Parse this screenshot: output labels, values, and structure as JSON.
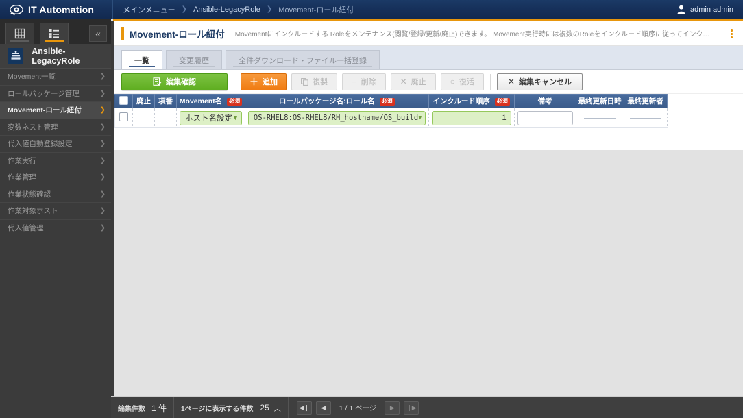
{
  "topbar": {
    "brand": "IT Automation",
    "logo_icon": "eye-logo-icon",
    "breadcrumb": [
      {
        "label": "メインメニュー",
        "type": "link"
      },
      {
        "label": "Ansible-LegacyRole",
        "type": "link"
      },
      {
        "label": "Movement-ロール紐付",
        "type": "current"
      }
    ],
    "breadcrumb_separator": "❯",
    "user": {
      "name": "admin admin",
      "icon": "user-avatar-icon"
    }
  },
  "sidebar": {
    "tabs": [
      {
        "name": "grid-view-icon",
        "active": false
      },
      {
        "name": "list-view-icon",
        "active": true
      }
    ],
    "collapse_icon": "«",
    "menu_title": "Ansible-LegacyRole",
    "menu_icon": "ansible-legacyrole-icon",
    "items": [
      {
        "label": "Movement一覧",
        "active": false
      },
      {
        "label": "ロールパッケージ管理",
        "active": false
      },
      {
        "label": "Movement-ロール紐付",
        "active": true
      },
      {
        "label": "変数ネスト管理",
        "active": false
      },
      {
        "label": "代入値自動登録設定",
        "active": false
      },
      {
        "label": "作業実行",
        "active": false
      },
      {
        "label": "作業管理",
        "active": false
      },
      {
        "label": "作業状態確認",
        "active": false
      },
      {
        "label": "作業対象ホスト",
        "active": false
      },
      {
        "label": "代入値管理",
        "active": false
      }
    ],
    "chevron": "❯"
  },
  "page": {
    "title": "Movement-ロール紐付",
    "description": "Movementにインクルードする Roleをメンテナンス(閲覧/登録/更新/廃止)できます。 Movement実行時には複数のRoleをインクルード順序に従ってインクルードすることが可能で…",
    "kebab_icon": "more-vertical-icon"
  },
  "tabs": [
    {
      "label": "一覧",
      "active": true
    },
    {
      "label": "変更履歴",
      "active": false
    },
    {
      "label": "全件ダウンロード・ファイル一括登録",
      "active": false
    }
  ],
  "toolbar": {
    "confirm_edit": {
      "label": "編集確認",
      "icon": "document-check-icon",
      "enabled": true
    },
    "add": {
      "label": "追加",
      "icon": "plus-icon",
      "enabled": true
    },
    "duplicate": {
      "label": "複製",
      "icon": "copy-icon",
      "enabled": false
    },
    "delete": {
      "label": "削除",
      "icon": "minus-icon",
      "enabled": false
    },
    "discontinue": {
      "label": "廃止",
      "icon": "x-icon",
      "enabled": false
    },
    "restore": {
      "label": "復活",
      "icon": "circle-icon",
      "enabled": false
    },
    "cancel_edit": {
      "label": "編集キャンセル",
      "icon": "x-icon",
      "enabled": true
    }
  },
  "table": {
    "required_badge": "必須",
    "columns": [
      {
        "key": "check",
        "label": "",
        "required": false
      },
      {
        "key": "discontinue",
        "label": "廃止",
        "required": false
      },
      {
        "key": "no",
        "label": "項番",
        "required": false
      },
      {
        "key": "movement",
        "label": "Movement名",
        "required": true
      },
      {
        "key": "rolepkg",
        "label": "ロールパッケージ名:ロール名",
        "required": true
      },
      {
        "key": "order",
        "label": "インクルード順序",
        "required": true
      },
      {
        "key": "remarks",
        "label": "備考",
        "required": false
      },
      {
        "key": "updated_at",
        "label": "最終更新日時",
        "required": false
      },
      {
        "key": "updated_by",
        "label": "最終更新者",
        "required": false
      }
    ],
    "rows": [
      {
        "check": "",
        "discontinue": "—",
        "no": "—",
        "movement": "ホスト名設定",
        "rolepkg": "OS-RHEL8:OS-RHEL8/RH_hostname/OS_build",
        "order": "1",
        "remarks": "",
        "updated_at": "",
        "updated_by": ""
      }
    ]
  },
  "footer": {
    "edit_count_label": "編集件数",
    "edit_count_value": "1 件",
    "per_page_label": "1ページに表示する件数",
    "per_page_value": "25",
    "per_page_caret": "︿",
    "first_icon": "first-page-icon",
    "prev_icon": "prev-page-icon",
    "page_text": "1 / 1 ページ",
    "next_icon": "next-page-icon",
    "last_icon": "last-page-icon"
  },
  "colors": {
    "topbar": "#16305a",
    "accent_orange": "#e8960c",
    "primary_green": "#5fae21",
    "add_orange": "#f07c13",
    "table_header": "#3a5b8a",
    "required_red": "#d9321f",
    "field_green_bg": "#ddf0c6",
    "field_green_border": "#95c85c"
  }
}
